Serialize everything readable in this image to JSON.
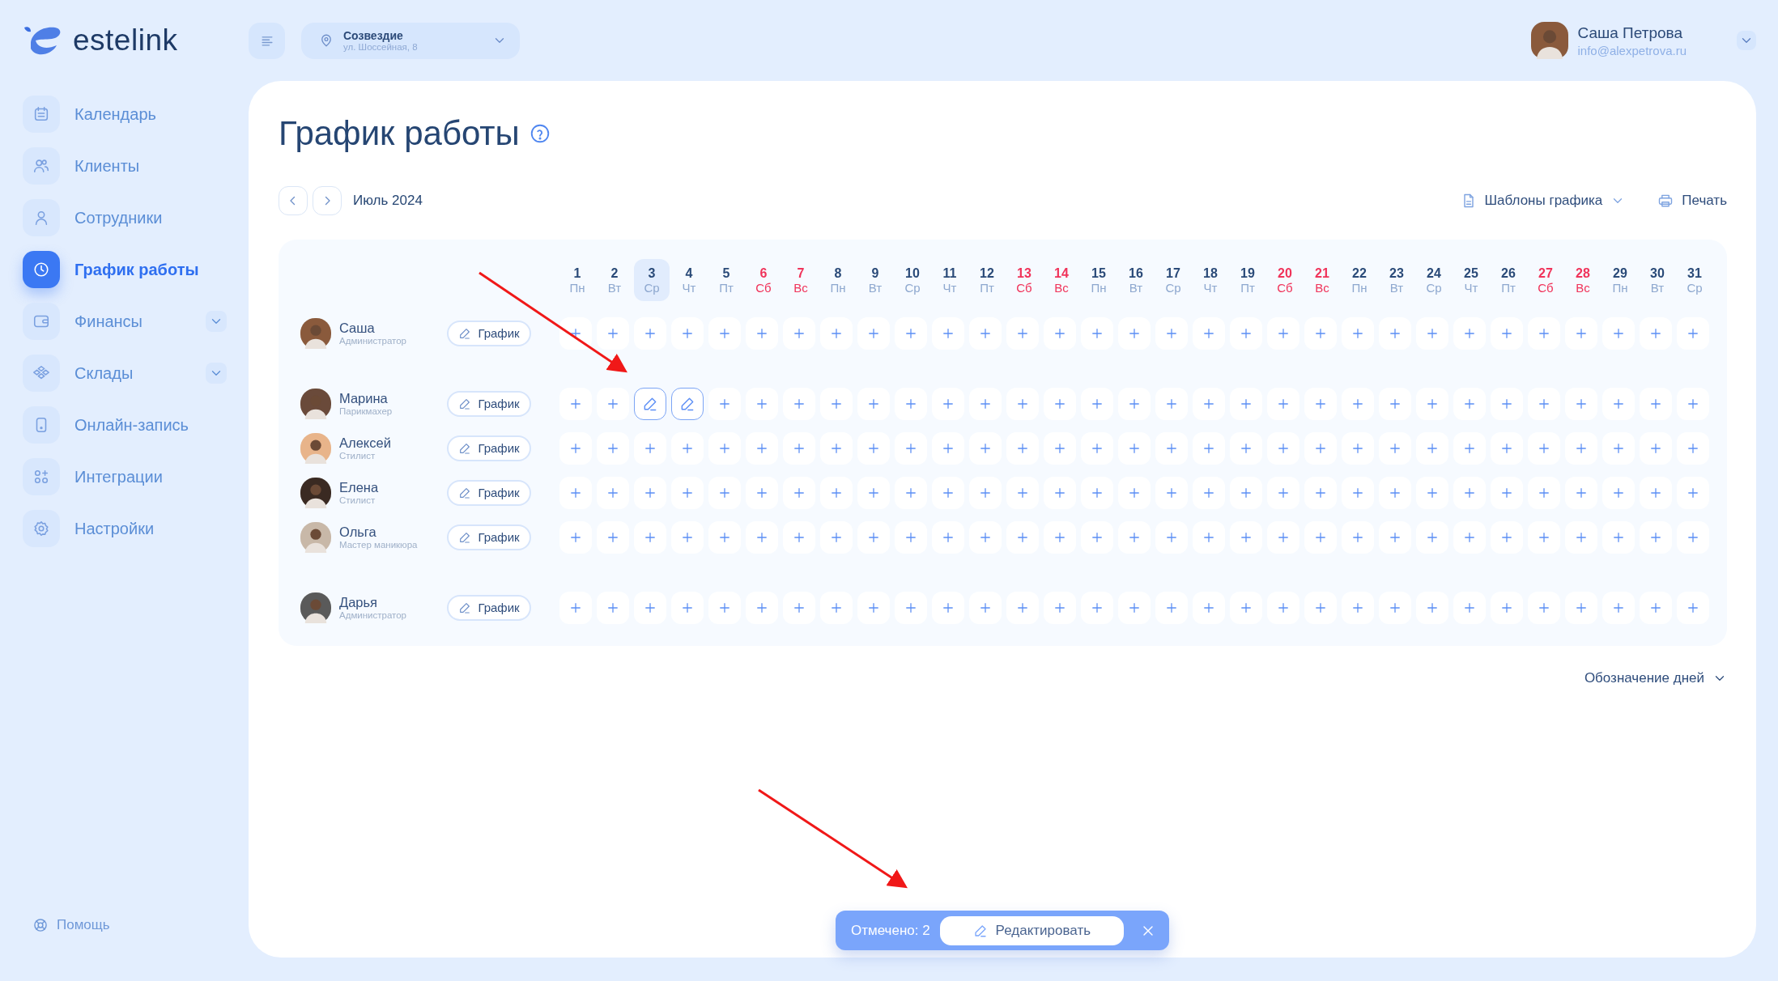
{
  "logo": {
    "text": "estelink"
  },
  "topbar": {
    "location": {
      "name": "Созвездие",
      "address": "ул. Шоссейная, 8"
    },
    "user": {
      "name": "Саша Петрова",
      "email": "info@alexpetrova.ru"
    }
  },
  "sidebar": {
    "items": [
      {
        "label": "Календарь",
        "selected": false,
        "expandable": false
      },
      {
        "label": "Клиенты",
        "selected": false,
        "expandable": false
      },
      {
        "label": "Сотрудники",
        "selected": false,
        "expandable": false
      },
      {
        "label": "График работы",
        "selected": true,
        "expandable": false
      },
      {
        "label": "Финансы",
        "selected": false,
        "expandable": true
      },
      {
        "label": "Склады",
        "selected": false,
        "expandable": true
      },
      {
        "label": "Онлайн-запись",
        "selected": false,
        "expandable": false
      },
      {
        "label": "Интеграции",
        "selected": false,
        "expandable": false
      },
      {
        "label": "Настройки",
        "selected": false,
        "expandable": false
      }
    ],
    "help": "Помощь"
  },
  "page": {
    "title": "График работы",
    "month": "Июль 2024",
    "templates_button": "Шаблоны графика",
    "print_button": "Печать",
    "legend_button": "Обозначение дней"
  },
  "schedule": {
    "columns": [
      {
        "day": "1",
        "weekday": "Пн",
        "weekend": false,
        "today": false
      },
      {
        "day": "2",
        "weekday": "Вт",
        "weekend": false,
        "today": false
      },
      {
        "day": "3",
        "weekday": "Ср",
        "weekend": false,
        "today": true
      },
      {
        "day": "4",
        "weekday": "Чт",
        "weekend": false,
        "today": false
      },
      {
        "day": "5",
        "weekday": "Пт",
        "weekend": false,
        "today": false
      },
      {
        "day": "6",
        "weekday": "Сб",
        "weekend": true,
        "today": false
      },
      {
        "day": "7",
        "weekday": "Вс",
        "weekend": true,
        "today": false
      },
      {
        "day": "8",
        "weekday": "Пн",
        "weekend": false,
        "today": false
      },
      {
        "day": "9",
        "weekday": "Вт",
        "weekend": false,
        "today": false
      },
      {
        "day": "10",
        "weekday": "Ср",
        "weekend": false,
        "today": false
      },
      {
        "day": "11",
        "weekday": "Чт",
        "weekend": false,
        "today": false
      },
      {
        "day": "12",
        "weekday": "Пт",
        "weekend": false,
        "today": false
      },
      {
        "day": "13",
        "weekday": "Сб",
        "weekend": true,
        "today": false
      },
      {
        "day": "14",
        "weekday": "Вс",
        "weekend": true,
        "today": false
      },
      {
        "day": "15",
        "weekday": "Пн",
        "weekend": false,
        "today": false
      },
      {
        "day": "16",
        "weekday": "Вт",
        "weekend": false,
        "today": false
      },
      {
        "day": "17",
        "weekday": "Ср",
        "weekend": false,
        "today": false
      },
      {
        "day": "18",
        "weekday": "Чт",
        "weekend": false,
        "today": false
      },
      {
        "day": "19",
        "weekday": "Пт",
        "weekend": false,
        "today": false
      },
      {
        "day": "20",
        "weekday": "Сб",
        "weekend": true,
        "today": false
      },
      {
        "day": "21",
        "weekday": "Вс",
        "weekend": true,
        "today": false
      },
      {
        "day": "22",
        "weekday": "Пн",
        "weekend": false,
        "today": false
      },
      {
        "day": "23",
        "weekday": "Вт",
        "weekend": false,
        "today": false
      },
      {
        "day": "24",
        "weekday": "Ср",
        "weekend": false,
        "today": false
      },
      {
        "day": "25",
        "weekday": "Чт",
        "weekend": false,
        "today": false
      },
      {
        "day": "26",
        "weekday": "Пт",
        "weekend": false,
        "today": false
      },
      {
        "day": "27",
        "weekday": "Сб",
        "weekend": true,
        "today": false
      },
      {
        "day": "28",
        "weekday": "Вс",
        "weekend": true,
        "today": false
      },
      {
        "day": "29",
        "weekday": "Пн",
        "weekend": false,
        "today": false
      },
      {
        "day": "30",
        "weekday": "Вт",
        "weekend": false,
        "today": false
      },
      {
        "day": "31",
        "weekday": "Ср",
        "weekend": false,
        "today": false
      }
    ],
    "rows": [
      {
        "name": "Саша",
        "role": "Администратор",
        "button": "График",
        "days": [
          {
            "selected": false
          },
          {
            "selected": false
          },
          {
            "selected": false
          },
          {
            "selected": false
          },
          {
            "selected": false
          },
          {
            "selected": false
          },
          {
            "selected": false
          },
          {
            "selected": false
          },
          {
            "selected": false
          },
          {
            "selected": false
          },
          {
            "selected": false
          },
          {
            "selected": false
          },
          {
            "selected": false
          },
          {
            "selected": false
          },
          {
            "selected": false
          },
          {
            "selected": false
          },
          {
            "selected": false
          },
          {
            "selected": false
          },
          {
            "selected": false
          },
          {
            "selected": false
          },
          {
            "selected": false
          },
          {
            "selected": false
          },
          {
            "selected": false
          },
          {
            "selected": false
          },
          {
            "selected": false
          },
          {
            "selected": false
          },
          {
            "selected": false
          },
          {
            "selected": false
          },
          {
            "selected": false
          },
          {
            "selected": false
          },
          {
            "selected": false
          }
        ]
      },
      {
        "name": "Марина",
        "role": "Парикмахер",
        "button": "График",
        "days": [
          {
            "selected": false
          },
          {
            "selected": false
          },
          {
            "selected": true
          },
          {
            "selected": true
          },
          {
            "selected": false
          },
          {
            "selected": false
          },
          {
            "selected": false
          },
          {
            "selected": false
          },
          {
            "selected": false
          },
          {
            "selected": false
          },
          {
            "selected": false
          },
          {
            "selected": false
          },
          {
            "selected": false
          },
          {
            "selected": false
          },
          {
            "selected": false
          },
          {
            "selected": false
          },
          {
            "selected": false
          },
          {
            "selected": false
          },
          {
            "selected": false
          },
          {
            "selected": false
          },
          {
            "selected": false
          },
          {
            "selected": false
          },
          {
            "selected": false
          },
          {
            "selected": false
          },
          {
            "selected": false
          },
          {
            "selected": false
          },
          {
            "selected": false
          },
          {
            "selected": false
          },
          {
            "selected": false
          },
          {
            "selected": false
          },
          {
            "selected": false
          }
        ]
      },
      {
        "name": "Алексей",
        "role": "Стилист",
        "button": "График",
        "days": [
          {
            "selected": false
          },
          {
            "selected": false
          },
          {
            "selected": false
          },
          {
            "selected": false
          },
          {
            "selected": false
          },
          {
            "selected": false
          },
          {
            "selected": false
          },
          {
            "selected": false
          },
          {
            "selected": false
          },
          {
            "selected": false
          },
          {
            "selected": false
          },
          {
            "selected": false
          },
          {
            "selected": false
          },
          {
            "selected": false
          },
          {
            "selected": false
          },
          {
            "selected": false
          },
          {
            "selected": false
          },
          {
            "selected": false
          },
          {
            "selected": false
          },
          {
            "selected": false
          },
          {
            "selected": false
          },
          {
            "selected": false
          },
          {
            "selected": false
          },
          {
            "selected": false
          },
          {
            "selected": false
          },
          {
            "selected": false
          },
          {
            "selected": false
          },
          {
            "selected": false
          },
          {
            "selected": false
          },
          {
            "selected": false
          },
          {
            "selected": false
          }
        ]
      },
      {
        "name": "Елена",
        "role": "Стилист",
        "button": "График",
        "days": [
          {
            "selected": false
          },
          {
            "selected": false
          },
          {
            "selected": false
          },
          {
            "selected": false
          },
          {
            "selected": false
          },
          {
            "selected": false
          },
          {
            "selected": false
          },
          {
            "selected": false
          },
          {
            "selected": false
          },
          {
            "selected": false
          },
          {
            "selected": false
          },
          {
            "selected": false
          },
          {
            "selected": false
          },
          {
            "selected": false
          },
          {
            "selected": false
          },
          {
            "selected": false
          },
          {
            "selected": false
          },
          {
            "selected": false
          },
          {
            "selected": false
          },
          {
            "selected": false
          },
          {
            "selected": false
          },
          {
            "selected": false
          },
          {
            "selected": false
          },
          {
            "selected": false
          },
          {
            "selected": false
          },
          {
            "selected": false
          },
          {
            "selected": false
          },
          {
            "selected": false
          },
          {
            "selected": false
          },
          {
            "selected": false
          },
          {
            "selected": false
          }
        ]
      },
      {
        "name": "Ольга",
        "role": "Мастер маникюра",
        "button": "График",
        "days": [
          {
            "selected": false
          },
          {
            "selected": false
          },
          {
            "selected": false
          },
          {
            "selected": false
          },
          {
            "selected": false
          },
          {
            "selected": false
          },
          {
            "selected": false
          },
          {
            "selected": false
          },
          {
            "selected": false
          },
          {
            "selected": false
          },
          {
            "selected": false
          },
          {
            "selected": false
          },
          {
            "selected": false
          },
          {
            "selected": false
          },
          {
            "selected": false
          },
          {
            "selected": false
          },
          {
            "selected": false
          },
          {
            "selected": false
          },
          {
            "selected": false
          },
          {
            "selected": false
          },
          {
            "selected": false
          },
          {
            "selected": false
          },
          {
            "selected": false
          },
          {
            "selected": false
          },
          {
            "selected": false
          },
          {
            "selected": false
          },
          {
            "selected": false
          },
          {
            "selected": false
          },
          {
            "selected": false
          },
          {
            "selected": false
          },
          {
            "selected": false
          }
        ]
      },
      {
        "name": "Дарья",
        "role": "Администратор",
        "button": "График",
        "days": [
          {
            "selected": false
          },
          {
            "selected": false
          },
          {
            "selected": false
          },
          {
            "selected": false
          },
          {
            "selected": false
          },
          {
            "selected": false
          },
          {
            "selected": false
          },
          {
            "selected": false
          },
          {
            "selected": false
          },
          {
            "selected": false
          },
          {
            "selected": false
          },
          {
            "selected": false
          },
          {
            "selected": false
          },
          {
            "selected": false
          },
          {
            "selected": false
          },
          {
            "selected": false
          },
          {
            "selected": false
          },
          {
            "selected": false
          },
          {
            "selected": false
          },
          {
            "selected": false
          },
          {
            "selected": false
          },
          {
            "selected": false
          },
          {
            "selected": false
          },
          {
            "selected": false
          },
          {
            "selected": false
          },
          {
            "selected": false
          },
          {
            "selected": false
          },
          {
            "selected": false
          },
          {
            "selected": false
          },
          {
            "selected": false
          },
          {
            "selected": false
          }
        ]
      }
    ]
  },
  "selection_bar": {
    "count_label": "Отмечено: 2",
    "edit_button": "Редактировать"
  }
}
